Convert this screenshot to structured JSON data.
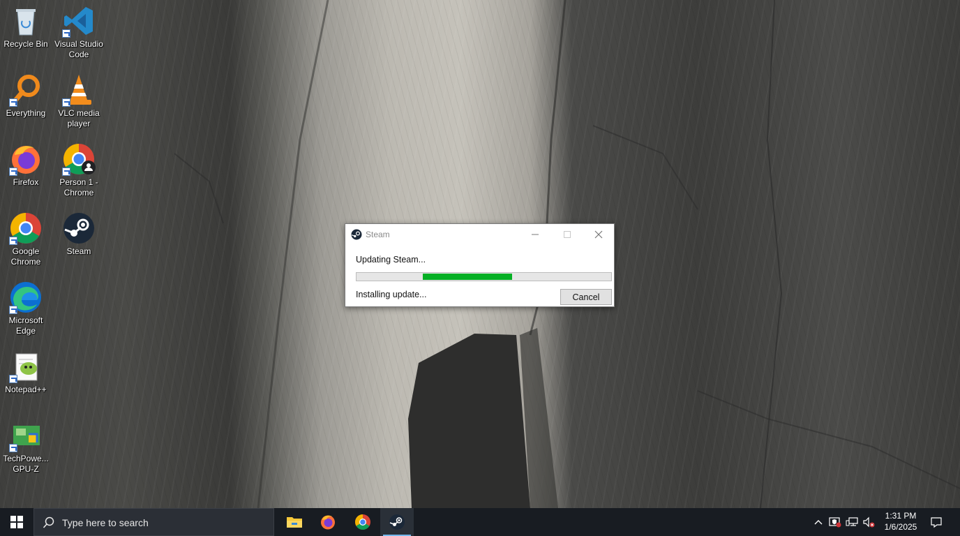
{
  "desktop": {
    "icons": [
      {
        "label": "Recycle Bin"
      },
      {
        "label": "Visual Studio Code"
      },
      {
        "label": "Everything"
      },
      {
        "label": "VLC media player"
      },
      {
        "label": "Firefox"
      },
      {
        "label": "Person 1 - Chrome"
      },
      {
        "label": "Google Chrome"
      },
      {
        "label": "Steam"
      },
      {
        "label": "Microsoft Edge"
      },
      {
        "label": "Notepad++"
      },
      {
        "label": "TechPowe... GPU-Z"
      }
    ]
  },
  "dialog": {
    "title": "Steam",
    "status": "Updating Steam...",
    "detail": "Installing update...",
    "cancel_label": "Cancel",
    "progress_start": 0.26,
    "progress_end": 0.61,
    "progress_color": "#06b025"
  },
  "taskbar": {
    "search_placeholder": "Type here to search",
    "pinned": [
      "file-explorer-icon",
      "firefox-icon",
      "chrome-icon",
      "steam-icon"
    ],
    "time": "1:31 PM",
    "date": "1/6/2025"
  }
}
